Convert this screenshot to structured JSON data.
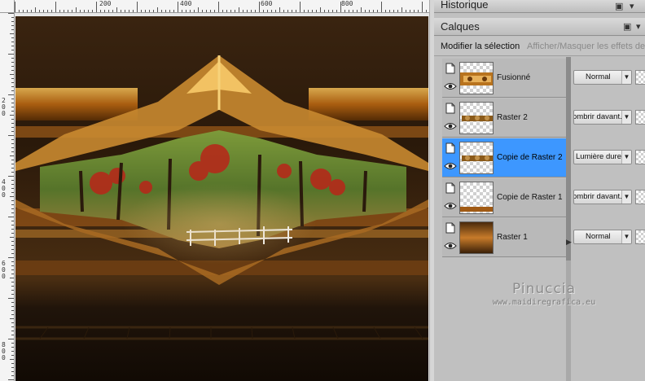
{
  "rulers": {
    "top_labels": [
      "200",
      "400",
      "600",
      "800"
    ],
    "left_labels": [
      "2\n0\n0",
      "4\n0\n0",
      "6\n0\n0",
      "8\n0\n0"
    ]
  },
  "panels": {
    "historique": {
      "title": "Historique"
    },
    "calques": {
      "title": "Calques",
      "pin_icon": "pin-icon",
      "menu_icon": "chevron-down-icon",
      "toolbar": {
        "modify_selection": "Modifier la sélection",
        "toggle_effects": "Afficher/Masquer les effets de"
      },
      "layers": [
        {
          "name": "Fusionné",
          "blend": "Normal",
          "selected": false
        },
        {
          "name": "Raster 2",
          "blend": "ombrir davant.",
          "selected": false
        },
        {
          "name": "Copie de Raster 2",
          "blend": "Lumière dure",
          "selected": true
        },
        {
          "name": "Copie de Raster 1",
          "blend": "ombrir davant.",
          "selected": false
        },
        {
          "name": "Raster 1",
          "blend": "Normal",
          "selected": false
        }
      ]
    }
  },
  "watermark": {
    "name": "Pinuccia",
    "url": "www.maidiregrafica.eu"
  },
  "colors": {
    "selection": "#3d97ff",
    "gold": "#e8a030",
    "canvas_bg": "#1c1208"
  }
}
